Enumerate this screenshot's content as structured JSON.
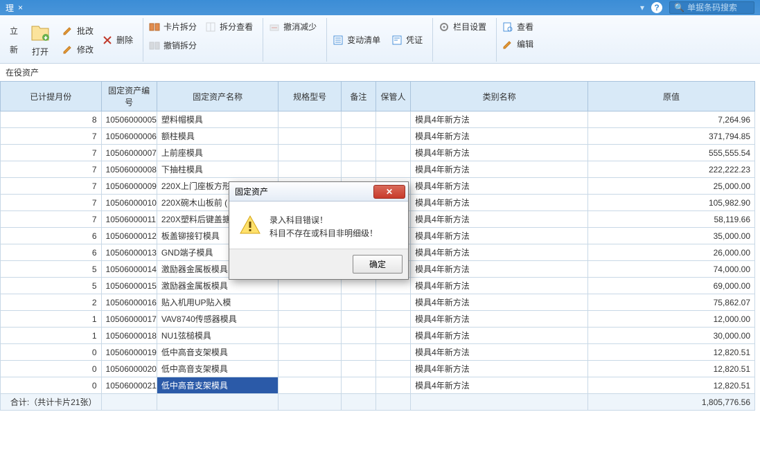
{
  "titlebar": {
    "tab_label": "理",
    "help_icon": "help-icon",
    "menu_icon": "dropdown-icon",
    "search_icon": "search-icon",
    "search_placeholder": "单据条码搜索"
  },
  "toolbar": {
    "group1": {
      "col1_top": "立",
      "col1_bottom": "新",
      "open": "打开",
      "batch": "批改",
      "delete": "删除",
      "modify": "修改"
    },
    "group2": {
      "card_split": "卡片拆分",
      "undo_split": "撤销拆分",
      "split_view": "拆分查看"
    },
    "group3": {
      "undo_reduce": "撤消减少"
    },
    "group4": {
      "change_list": "变动清单",
      "voucher": "凭证"
    },
    "group5": {
      "column_setting": "栏目设置"
    },
    "group6": {
      "view": "查看",
      "edit": "编辑"
    }
  },
  "breadcrumb": "在役资产",
  "columns": {
    "month": "已计提月份",
    "code": "固定资产编号",
    "name": "固定资产名称",
    "spec": "规格型号",
    "note": "备注",
    "keeper": "保管人",
    "cat": "类别名称",
    "value": "原值"
  },
  "rows": [
    {
      "month": "8",
      "code": "10506000005",
      "name": "塑料帽模具",
      "cat": "模具4年新方法",
      "value": "7,264.96"
    },
    {
      "month": "7",
      "code": "10506000006",
      "name": "额柱模具",
      "cat": "模具4年新方法",
      "value": "371,794.85"
    },
    {
      "month": "7",
      "code": "10506000007",
      "name": "上前座模具",
      "cat": "模具4年新方法",
      "value": "555,555.54"
    },
    {
      "month": "7",
      "code": "10506000008",
      "name": "下抽柱模具",
      "cat": "模具4年新方法",
      "value": "222,222.23"
    },
    {
      "month": "7",
      "code": "10506000009",
      "name": "220X上门座板方形",
      "cat": "模具4年新方法",
      "value": "25,000.00"
    },
    {
      "month": "7",
      "code": "10506000010",
      "name": "220X碗木山板前 (",
      "cat": "模具4年新方法",
      "value": "105,982.90"
    },
    {
      "month": "7",
      "code": "10506000011",
      "name": "220X塑料后键盖搪",
      "cat": "模具4年新方法",
      "value": "58,119.66"
    },
    {
      "month": "6",
      "code": "10506000012",
      "name": "板盖铆接钉模具",
      "cat": "模具4年新方法",
      "value": "35,000.00"
    },
    {
      "month": "6",
      "code": "10506000013",
      "name": "GND端子模具",
      "cat": "模具4年新方法",
      "value": "26,000.00"
    },
    {
      "month": "5",
      "code": "10506000014",
      "name": "激励器金属板模具",
      "cat": "模具4年新方法",
      "value": "74,000.00"
    },
    {
      "month": "5",
      "code": "10506000015",
      "name": "激励器金属板模具",
      "cat": "模具4年新方法",
      "value": "69,000.00"
    },
    {
      "month": "2",
      "code": "10506000016",
      "name": "贴入机用UP贴入模",
      "cat": "模具4年新方法",
      "value": "75,862.07"
    },
    {
      "month": "1",
      "code": "10506000017",
      "name": "VAV8740传感器模具",
      "cat": "模具4年新方法",
      "value": "12,000.00"
    },
    {
      "month": "1",
      "code": "10506000018",
      "name": "NU1弦槌模具",
      "cat": "模具4年新方法",
      "value": "30,000.00"
    },
    {
      "month": "0",
      "code": "10506000019",
      "name": "低中高音支架模具",
      "cat": "模具4年新方法",
      "value": "12,820.51"
    },
    {
      "month": "0",
      "code": "10506000020",
      "name": "低中高音支架模具",
      "cat": "模具4年新方法",
      "value": "12,820.51"
    },
    {
      "month": "0",
      "code": "10506000021",
      "name": "低中高音支架模具",
      "cat": "模具4年新方法",
      "value": "12,820.51",
      "selected": true
    }
  ],
  "footer": {
    "summary": "合计:（共计卡片21张）",
    "total": "1,805,776.56"
  },
  "modal": {
    "title": "固定资产",
    "line1": "录入科目错误！",
    "line2": "科目不存在或科目非明细级！",
    "ok": "确定"
  }
}
